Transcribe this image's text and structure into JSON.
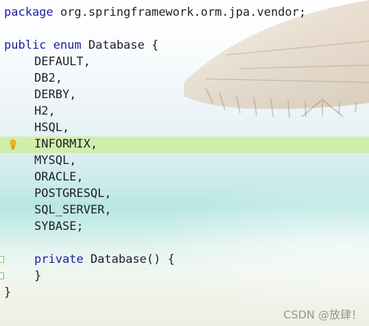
{
  "code": {
    "package_keyword": "package",
    "package_name": "org.springframework.orm.jpa.vendor;",
    "public_keyword": "public",
    "enum_keyword": "enum",
    "enum_name": "Database",
    "open_brace": "{",
    "constants": [
      "DEFAULT,",
      "DB2,",
      "DERBY,",
      "H2,",
      "HSQL,",
      "INFORMIX,",
      "MYSQL,",
      "ORACLE,",
      "POSTGRESQL,",
      "SQL_SERVER,",
      "SYBASE;"
    ],
    "private_keyword": "private",
    "constructor_sig": "Database() {",
    "constructor_close": "}",
    "close_brace": "}"
  },
  "editor": {
    "highlighted_constant": "INFORMIX,",
    "highlight_color": "#cdeea0",
    "keyword_color": "#1b1ba0",
    "intention_icon": "lightbulb-icon"
  },
  "watermark": {
    "text": "CSDN @放肆！"
  }
}
